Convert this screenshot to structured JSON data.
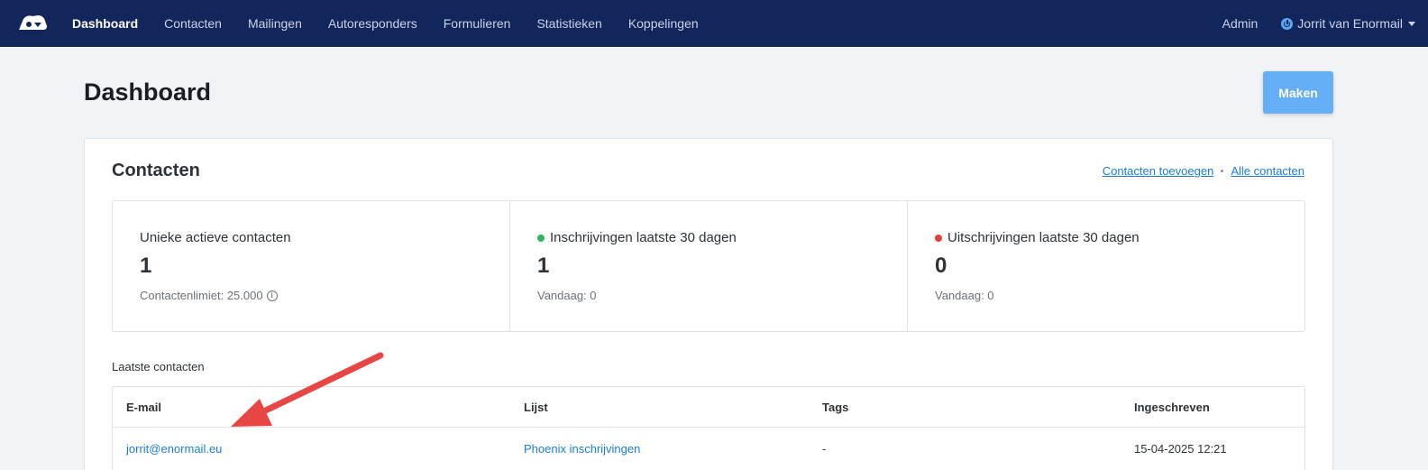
{
  "nav": {
    "items": [
      {
        "label": "Dashboard",
        "active": true
      },
      {
        "label": "Contacten",
        "active": false
      },
      {
        "label": "Mailingen",
        "active": false
      },
      {
        "label": "Autoresponders",
        "active": false
      },
      {
        "label": "Formulieren",
        "active": false
      },
      {
        "label": "Statistieken",
        "active": false
      },
      {
        "label": "Koppelingen",
        "active": false
      }
    ],
    "admin": "Admin",
    "user": "Jorrit van Enormail"
  },
  "page": {
    "title": "Dashboard",
    "create_button": "Maken"
  },
  "contacts_card": {
    "title": "Contacten",
    "link_add": "Contacten toevoegen",
    "link_all": "Alle contacten",
    "stats": [
      {
        "label": "Unieke actieve contacten",
        "value": "1",
        "sub": "Contactenlimiet: 25.000",
        "dot": null
      },
      {
        "label": "Inschrijvingen laatste 30 dagen",
        "value": "1",
        "sub": "Vandaag: 0",
        "dot": "#2fb35c"
      },
      {
        "label": "Uitschrijvingen laatste 30 dagen",
        "value": "0",
        "sub": "Vandaag: 0",
        "dot": "#ec3b3b"
      }
    ],
    "latest_label": "Laatste contacten",
    "table": {
      "columns": [
        "E-mail",
        "Lijst",
        "Tags",
        "Ingeschreven"
      ],
      "rows": [
        [
          "jorrit@enormail.eu",
          "Phoenix inschrijvingen",
          "-",
          "15-04-2025 12:21"
        ]
      ]
    }
  },
  "colors": {
    "navbar": "#13265c",
    "accent": "#66aef5",
    "link": "#1a7ed6",
    "arrow": "#e84545"
  }
}
